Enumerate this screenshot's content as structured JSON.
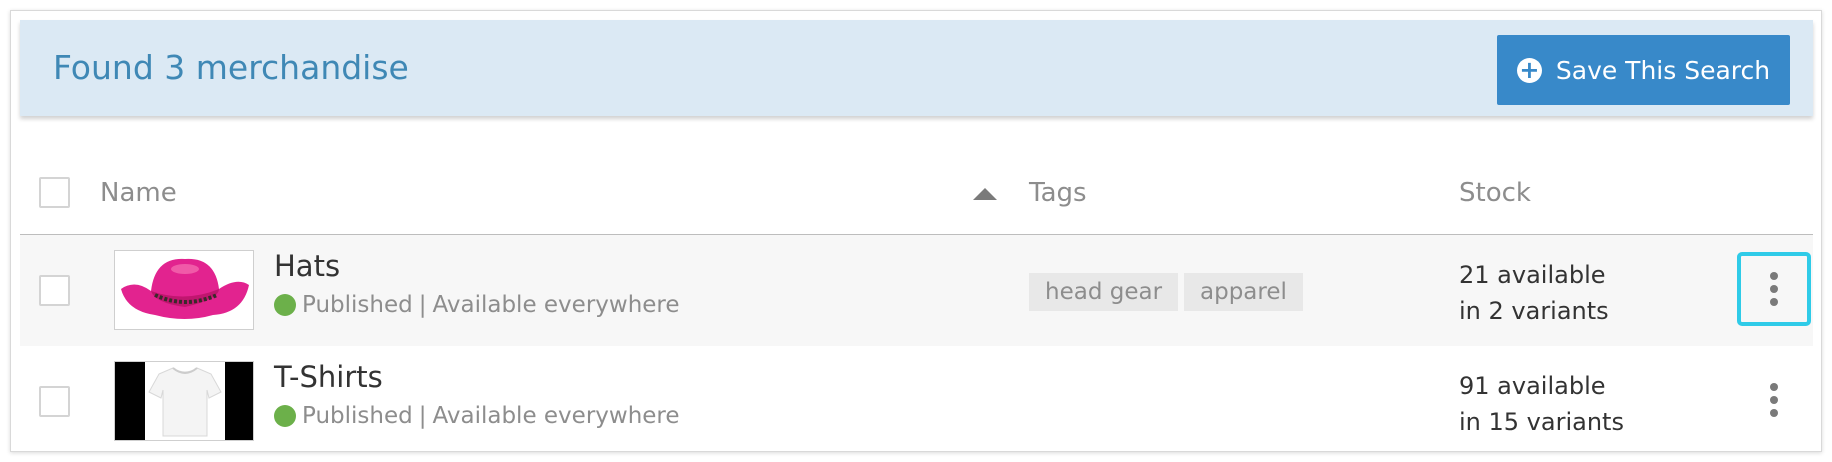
{
  "summary": {
    "title": "Found 3 merchandise",
    "save_button_label": "Save This Search",
    "save_button_icon": "plus-circle-icon"
  },
  "table": {
    "columns": {
      "name": "Name",
      "tags": "Tags",
      "stock": "Stock"
    },
    "sort": {
      "column": "name",
      "direction": "ascending",
      "icon": "sort-up-icon"
    },
    "rows": [
      {
        "name": "Hats",
        "image": "pink-cowboy-hat",
        "status_label": "Published",
        "separator": "|",
        "availability": "Available everywhere",
        "tags": [
          "head gear",
          "apparel"
        ],
        "stock_line1": "21 available",
        "stock_line2": "in 2 variants"
      },
      {
        "name": "T-Shirts",
        "image": "white-t-shirt",
        "status_label": "Published",
        "separator": "|",
        "availability": "Available everywhere",
        "tags": [],
        "stock_line1": "91 available",
        "stock_line2": "in 15 variants"
      }
    ]
  },
  "colors": {
    "summary_bg": "#dbe9f4",
    "summary_text": "#3f88b5",
    "primary_button": "#3889c9",
    "published_dot": "#6cb04a",
    "focus_ring": "#2fcbe8",
    "tag_bg": "#e8e8e8"
  }
}
